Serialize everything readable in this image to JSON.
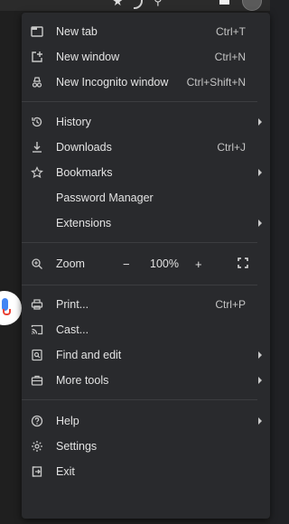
{
  "menu": {
    "new_tab": {
      "label": "New tab",
      "shortcut": "Ctrl+T"
    },
    "new_window": {
      "label": "New window",
      "shortcut": "Ctrl+N"
    },
    "new_incognito": {
      "label": "New Incognito window",
      "shortcut": "Ctrl+Shift+N"
    },
    "history": {
      "label": "History"
    },
    "downloads": {
      "label": "Downloads",
      "shortcut": "Ctrl+J"
    },
    "bookmarks": {
      "label": "Bookmarks"
    },
    "password_manager": {
      "label": "Password Manager"
    },
    "extensions": {
      "label": "Extensions"
    },
    "zoom": {
      "label": "Zoom",
      "minus": "−",
      "value": "100%",
      "plus": "+"
    },
    "print": {
      "label": "Print...",
      "shortcut": "Ctrl+P"
    },
    "cast": {
      "label": "Cast..."
    },
    "find_edit": {
      "label": "Find and edit"
    },
    "more_tools": {
      "label": "More tools"
    },
    "help": {
      "label": "Help"
    },
    "settings": {
      "label": "Settings"
    },
    "exit": {
      "label": "Exit"
    }
  },
  "colors": {
    "menu_bg": "#292a2d",
    "text": "#e3e3e3",
    "separator": "#3c3d40"
  }
}
